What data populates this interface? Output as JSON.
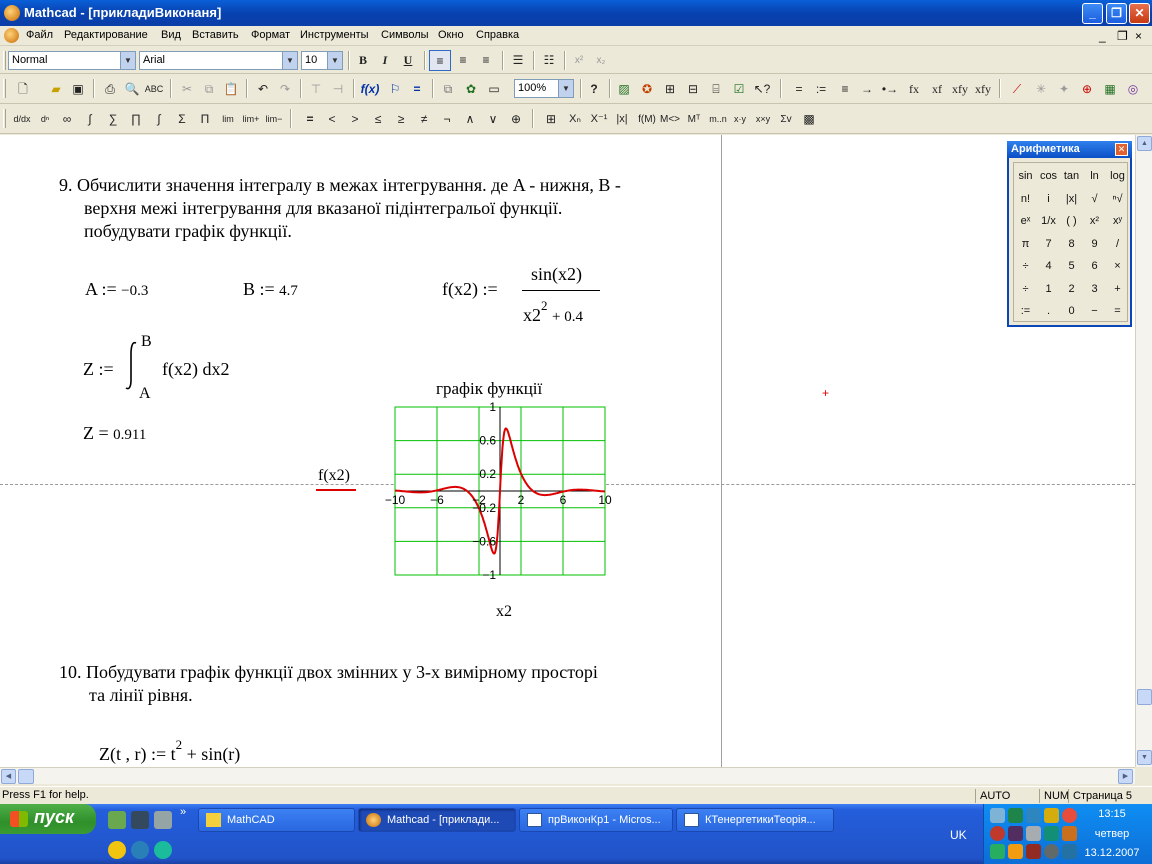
{
  "window": {
    "title": "Mathcad - [прикладиВиконаня]",
    "buttons": {
      "minimize": "_",
      "restore": "❐",
      "close": "✕"
    }
  },
  "menu": {
    "items": [
      "Файл",
      "Редактирование",
      "Вид",
      "Вставить",
      "Формат",
      "Инструменты",
      "Символы",
      "Окно",
      "Справка"
    ],
    "mdi": {
      "minimize": "_",
      "restore": "❐",
      "close": "×"
    }
  },
  "format_toolbar": {
    "style": "Normal",
    "font": "Arial",
    "size": "10",
    "bold": "B",
    "italic": "I",
    "underline": "U"
  },
  "standard_toolbar": {
    "zoom": "100%",
    "operators": [
      "=",
      ":=",
      "≡",
      "→",
      "•→",
      "fx",
      "xf",
      "xfy",
      "xfy"
    ]
  },
  "math_toolbar": {
    "relational": [
      "=",
      "<",
      ">",
      "≤",
      "≥",
      "≠",
      "¬",
      "∧",
      "∨",
      "⊕"
    ],
    "matrix_ops": [
      "Xₙ",
      "X⁻¹",
      "|x|",
      "M<>",
      "Mᵀ",
      "m..n"
    ]
  },
  "document": {
    "task9": {
      "number": "9.",
      "line1": "Обчислити значення інтегралу в межах інтегрування. де A - нижня, B -",
      "line2": "верхня межі інтегрування для вказаної підінтегральої функції.",
      "line3": "побудувати графік функції."
    },
    "defs": {
      "a_lhs": "A :=",
      "a_val": "−0.3",
      "b_lhs": "B :=",
      "b_val": "4.7",
      "f_lhs": "f(x2) :=",
      "f_num": "sin(x2)",
      "f_den": "x2",
      "f_den_exp": "2",
      "f_den_rest": "+ 0.4"
    },
    "integral": {
      "lhs": "Z :=",
      "upper": "B",
      "lower": "A",
      "body": "f(x2) dx2"
    },
    "result": {
      "lhs": "Z =",
      "value": "0.911"
    },
    "task10": {
      "number": "10.",
      "line1": "Побудувати графік функції двох змінних у 3-х вимірному просторі",
      "line2": "та лінії рівня."
    },
    "zdef": {
      "lhs": "Z(t , r) :=",
      "t": "t",
      "exp": "2",
      "rest": "+ sin(r)"
    }
  },
  "chart_data": {
    "type": "line",
    "title": "графік функції",
    "xlabel": "x2",
    "ylabel": "f(x2)",
    "xlim": [
      -10,
      10
    ],
    "ylim": [
      -1,
      1
    ],
    "x_ticks": [
      "−10",
      "−6",
      "−2",
      "2",
      "6",
      "10"
    ],
    "y_ticks": [
      "1",
      "0.6",
      "0.2",
      "−0.2",
      "−0.6",
      "−1"
    ],
    "grid": true,
    "line_color": "#dd0000",
    "grid_color": "#00c000",
    "function": "sin(x2)/(x2^2+0.4)",
    "series": [
      {
        "x": [
          -10,
          -8,
          -6,
          -5,
          -4,
          -3,
          -2,
          -1.5,
          -1,
          -0.8,
          -0.6,
          -0.4,
          -0.2,
          0,
          0.2,
          0.4,
          0.6,
          0.8,
          1,
          1.5,
          2,
          3,
          4,
          5,
          6,
          8,
          10
        ],
        "y": [
          0.005,
          -0.015,
          0.008,
          0.038,
          0.046,
          -0.015,
          -0.208,
          -0.375,
          -0.601,
          -0.688,
          -0.74,
          -0.695,
          -0.451,
          0,
          0.451,
          0.695,
          0.74,
          0.688,
          0.601,
          0.375,
          0.208,
          0.015,
          -0.046,
          -0.038,
          -0.008,
          0.015,
          -0.005
        ]
      }
    ]
  },
  "palette": {
    "title": "Арифметика",
    "close": "✕",
    "rows": [
      [
        "sin",
        "cos",
        "tan",
        "ln",
        "log"
      ],
      [
        "n!",
        "i",
        "|x|",
        "√",
        "ⁿ√"
      ],
      [
        "eˣ",
        "1/x",
        "( )",
        "x²",
        "xʸ"
      ],
      [
        "π",
        "7",
        "8",
        "9",
        "/"
      ],
      [
        "÷",
        "4",
        "5",
        "6",
        "×"
      ],
      [
        "÷",
        "1",
        "2",
        "3",
        "+"
      ],
      [
        ":=",
        ".",
        "0",
        "−",
        "="
      ]
    ]
  },
  "status": {
    "help": "Press F1 for help.",
    "mode": "AUTO",
    "num": "NUM",
    "page": "Страница 5"
  },
  "taskbar": {
    "start": "пуск",
    "tasks": [
      "MathCAD",
      "Mathcad - [приклади...",
      "прВиконКр1 - Micros...",
      "КТенергетикиТеорія..."
    ],
    "lang": "UK",
    "time": "13:15",
    "day": "четвер",
    "date": "13.12.2007"
  }
}
